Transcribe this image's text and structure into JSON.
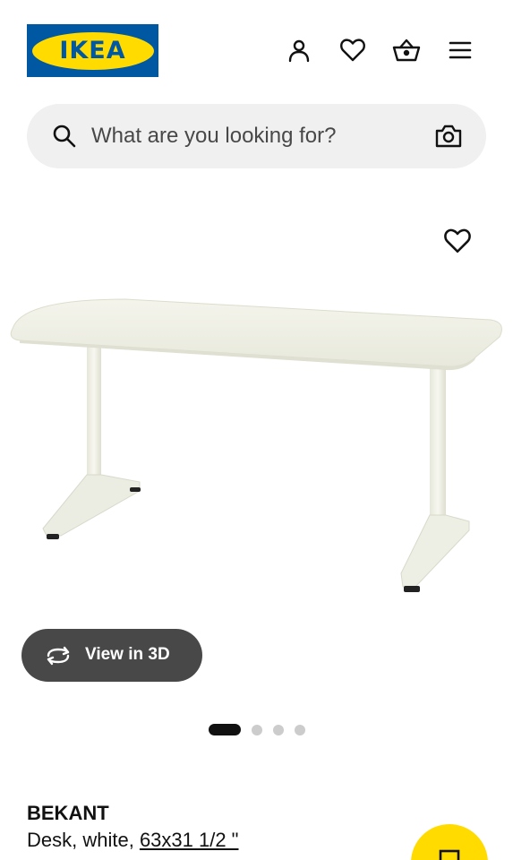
{
  "header": {
    "logo_text": "IKEA",
    "icons": [
      "account-icon",
      "heart-icon",
      "basket-icon",
      "menu-icon"
    ]
  },
  "search": {
    "placeholder": "What are you looking for?"
  },
  "product_media": {
    "view_3d_label": "View in 3D",
    "carousel": {
      "total": 4,
      "active": 1
    }
  },
  "product": {
    "name": "BEKANT",
    "description_prefix": "Desk, white, ",
    "size": "63x31 1/2 \""
  },
  "colors": {
    "brand_blue": "#0058a3",
    "brand_yellow": "#ffdb00",
    "search_bg": "#f0f0f0",
    "view3d_bg": "#484848",
    "text": "#111111"
  }
}
